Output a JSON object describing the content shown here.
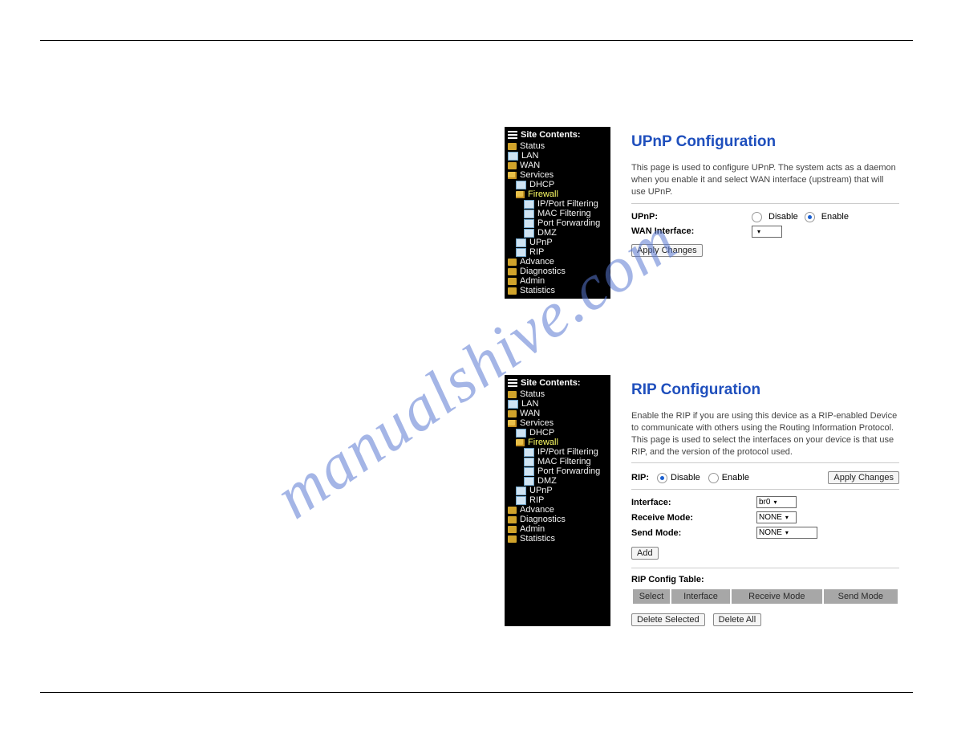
{
  "watermark": "manualshive.com",
  "tree": {
    "header": "Site Contents:",
    "items": [
      {
        "label": "Status",
        "icon": "folder"
      },
      {
        "label": "LAN",
        "icon": "doc"
      },
      {
        "label": "WAN",
        "icon": "folder"
      },
      {
        "label": "Services",
        "icon": "folder-open",
        "children": [
          {
            "label": "DHCP",
            "icon": "doc"
          },
          {
            "label": "Firewall",
            "icon": "folder-open",
            "yellow": true,
            "children": [
              {
                "label": "IP/Port Filtering",
                "icon": "doc"
              },
              {
                "label": "MAC Filtering",
                "icon": "doc"
              },
              {
                "label": "Port Forwarding",
                "icon": "doc"
              },
              {
                "label": "DMZ",
                "icon": "doc"
              }
            ]
          },
          {
            "label": "UPnP",
            "icon": "doc"
          },
          {
            "label": "RIP",
            "icon": "doc"
          }
        ]
      },
      {
        "label": "Advance",
        "icon": "folder"
      },
      {
        "label": "Diagnostics",
        "icon": "folder"
      },
      {
        "label": "Admin",
        "icon": "folder"
      },
      {
        "label": "Statistics",
        "icon": "folder"
      }
    ]
  },
  "upnp": {
    "title": "UPnP Configuration",
    "desc": "This page is used to configure UPnP. The system acts as a daemon when you enable it and select WAN interface (upstream) that will use UPnP.",
    "field1_label": "UPnP:",
    "disable": "Disable",
    "enable": "Enable",
    "selected": "enable",
    "field2_label": "WAN Interface:",
    "wan_value": "",
    "apply": "Apply Changes"
  },
  "rip": {
    "title": "RIP Configuration",
    "desc": "Enable the RIP if you are using this device as a RIP-enabled Device to communicate with others using the Routing Information Protocol. This page is used to select the interfaces on your device is that use RIP, and the version of the protocol used.",
    "field_rip": "RIP:",
    "disable": "Disable",
    "enable": "Enable",
    "selected": "disable",
    "apply": "Apply Changes",
    "interface_label": "Interface:",
    "interface_value": "br0",
    "receive_label": "Receive Mode:",
    "receive_value": "NONE",
    "send_label": "Send Mode:",
    "send_value": "NONE",
    "add": "Add",
    "table_title": "RIP Config Table:",
    "col1": "Select",
    "col2": "Interface",
    "col3": "Receive Mode",
    "col4": "Send Mode",
    "delete_selected": "Delete Selected",
    "delete_all": "Delete All"
  }
}
